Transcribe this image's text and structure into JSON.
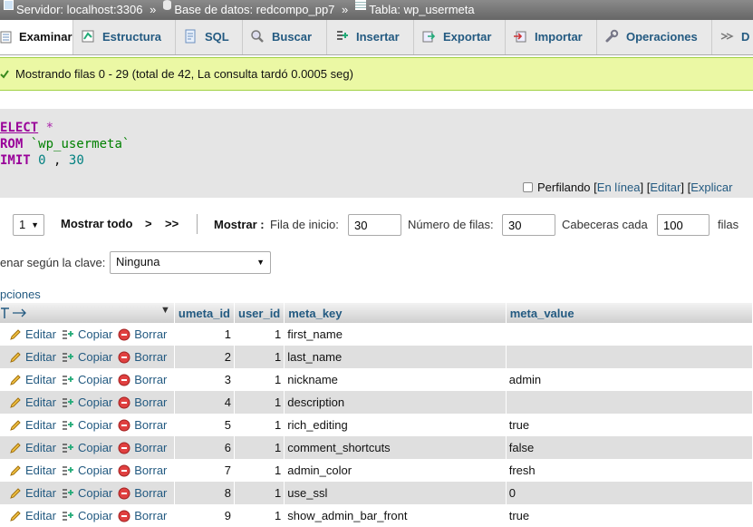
{
  "breadcrumb": {
    "server": "Servidor: localhost:3306",
    "database": "Base de datos: redcompo_pp7",
    "table": "Tabla: wp_usermeta",
    "separator": "»"
  },
  "tabs": [
    {
      "label": "Examinar",
      "icon": "browse-icon"
    },
    {
      "label": "Estructura",
      "icon": "structure-icon"
    },
    {
      "label": "SQL",
      "icon": "sql-icon"
    },
    {
      "label": "Buscar",
      "icon": "search-icon"
    },
    {
      "label": "Insertar",
      "icon": "insert-icon"
    },
    {
      "label": "Exportar",
      "icon": "export-icon"
    },
    {
      "label": "Importar",
      "icon": "import-icon"
    },
    {
      "label": "Operaciones",
      "icon": "wrench-icon"
    },
    {
      "label": "D",
      "icon": "triggers-icon"
    }
  ],
  "success": {
    "message": "Mostrando filas 0 - 29 (total de 42, La consulta tardó 0.0005 seg)"
  },
  "sql": {
    "kw_select": "ELECT",
    "star": "*",
    "kw_from": "ROM",
    "table": "`wp_usermeta`",
    "kw_limit": "IMIT",
    "offset": "0",
    "comma": ",",
    "rows": "30"
  },
  "profiling": {
    "label": "Perfilando",
    "open": "[",
    "close": "]",
    "inline": "En línea",
    "edit": "Editar",
    "explain": "Explicar"
  },
  "nav": {
    "page": "1",
    "show_all": "Mostrar todo",
    "next": ">",
    "last": ">>",
    "show_label": "Mostrar :",
    "start_row_label": "Fila de inicio:",
    "start_row": "30",
    "num_rows_label": "Número de filas:",
    "num_rows": "30",
    "headers_every_label": "Cabeceras cada",
    "headers_every": "100",
    "rows_suffix": "filas"
  },
  "sort": {
    "label": "enar según la clave:",
    "value": "Ninguna"
  },
  "options_label": "pciones",
  "table": {
    "headers": [
      "umeta_id",
      "user_id",
      "meta_key",
      "meta_value"
    ],
    "actions": {
      "edit": "Editar",
      "copy": "Copiar",
      "delete": "Borrar"
    },
    "rows": [
      {
        "umeta_id": "1",
        "user_id": "1",
        "meta_key": "first_name",
        "meta_value": ""
      },
      {
        "umeta_id": "2",
        "user_id": "1",
        "meta_key": "last_name",
        "meta_value": ""
      },
      {
        "umeta_id": "3",
        "user_id": "1",
        "meta_key": "nickname",
        "meta_value": "admin"
      },
      {
        "umeta_id": "4",
        "user_id": "1",
        "meta_key": "description",
        "meta_value": ""
      },
      {
        "umeta_id": "5",
        "user_id": "1",
        "meta_key": "rich_editing",
        "meta_value": "true"
      },
      {
        "umeta_id": "6",
        "user_id": "1",
        "meta_key": "comment_shortcuts",
        "meta_value": "false"
      },
      {
        "umeta_id": "7",
        "user_id": "1",
        "meta_key": "admin_color",
        "meta_value": "fresh"
      },
      {
        "umeta_id": "8",
        "user_id": "1",
        "meta_key": "use_ssl",
        "meta_value": "0"
      },
      {
        "umeta_id": "9",
        "user_id": "1",
        "meta_key": "show_admin_bar_front",
        "meta_value": "true"
      }
    ]
  },
  "colors": {
    "link": "#235a81",
    "success_bg": "#ebf8a4",
    "row_even": "#dfdfdf",
    "breadcrumb_bg": "#777777"
  }
}
